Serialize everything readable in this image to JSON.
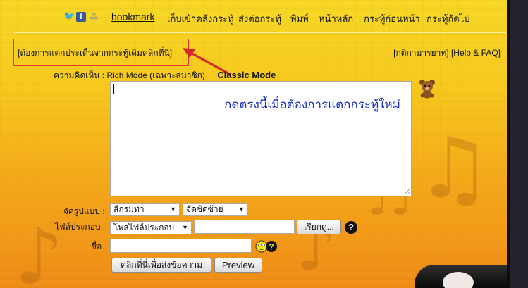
{
  "nav": {
    "icons": [
      "twitter-icon",
      "facebook-icon",
      "share-icon"
    ],
    "links": [
      "bookmark",
      "เก็บเข้าคลังกระทู้",
      "ส่งต่อกระทู้",
      "พิมพ์",
      "หน้าหลัก",
      "กระทู้ก่อนหน้า",
      "กระทู้ถัดไป"
    ]
  },
  "branch_link": "[ต้องการแตกประเด็นจากกระทู้เดิมคลิกที่นี่]",
  "rules_links": "[กติกามารยาท] [Help & FAQ]",
  "comment_label": "ความคิดเห็น : Rich Mode (เฉพาะสมาชิก)",
  "classic_mode": "Classic Mode",
  "annotation_text": "กดตรงนี้เมื่อต้องการแตกกระทู้ใหม่",
  "format_label": "จัดรูปแบบ :",
  "attach_label": "ไฟล์ประกอบ",
  "name_label": "ชื่อ",
  "color_select": "สีกรมท่า",
  "align_select": "จัดชิดซ้าย",
  "filetype_select": "โพสไฟล์ประกอบ",
  "browse_button": "เรียกดู...",
  "help_symbol": "?",
  "submit_button": "คลิกที่นี่เพื่อส่งข้อความ",
  "preview_button": "Preview",
  "colors": {
    "annotation": "#1b2fc6",
    "highlight_box": "#e4352a",
    "arrow": "#d8262a",
    "background_top": "#f6d826",
    "background_bottom": "#ef8c18"
  }
}
